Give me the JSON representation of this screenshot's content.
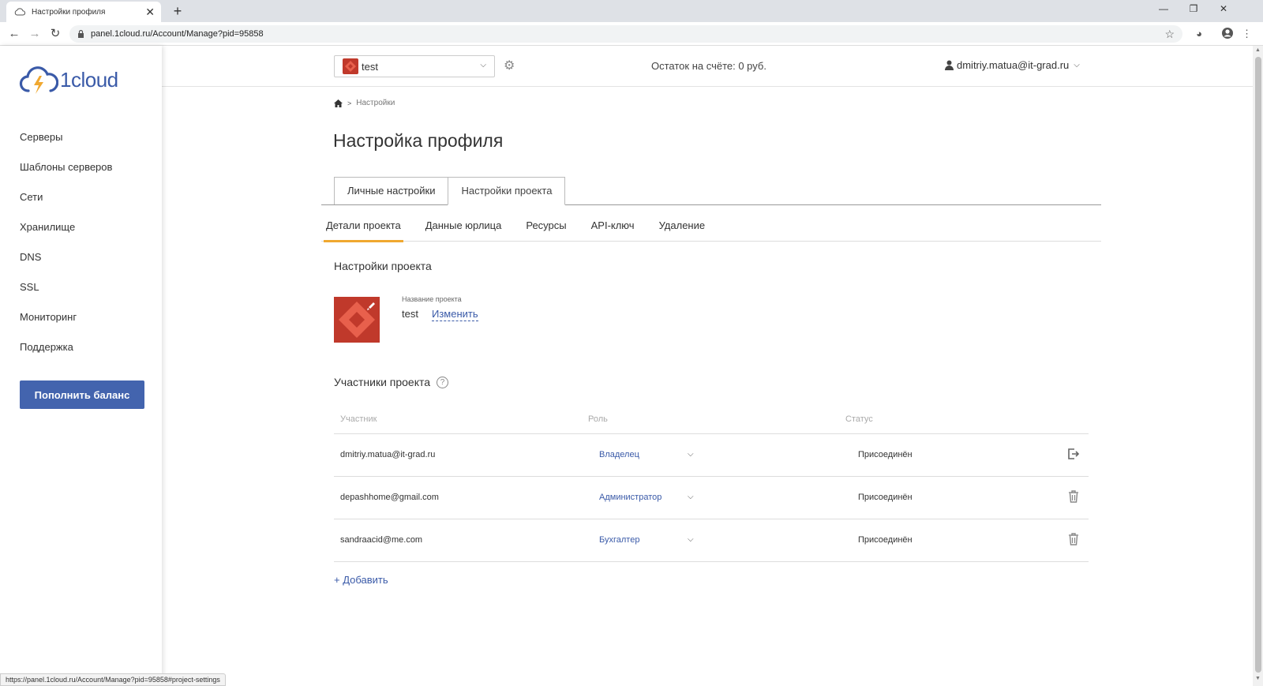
{
  "browser": {
    "tab_title": "Настройки профиля",
    "url": "panel.1cloud.ru/Account/Manage?pid=95858",
    "status_url": "https://panel.1cloud.ru/Account/Manage?pid=95858#project-settings"
  },
  "sidebar": {
    "logo_text": "1cloud",
    "items": [
      {
        "label": "Серверы"
      },
      {
        "label": "Шаблоны серверов"
      },
      {
        "label": "Сети"
      },
      {
        "label": "Хранилище"
      },
      {
        "label": "DNS"
      },
      {
        "label": "SSL"
      },
      {
        "label": "Мониторинг"
      },
      {
        "label": "Поддержка"
      }
    ],
    "topup_label": "Пополнить баланс"
  },
  "header": {
    "project": "test",
    "balance": "Остаток на счёте: 0 руб.",
    "user": "dmitriy.matua@it-grad.ru"
  },
  "main": {
    "breadcrumb": "Настройки",
    "title": "Настройка профиля",
    "tabs": [
      {
        "label": "Личные настройки"
      },
      {
        "label": "Настройки проекта"
      }
    ],
    "subtabs": [
      {
        "label": "Детали проекта"
      },
      {
        "label": "Данные юрлица"
      },
      {
        "label": "Ресурсы"
      },
      {
        "label": "API-ключ"
      },
      {
        "label": "Удаление"
      }
    ],
    "settings_title": "Настройки проекта",
    "project_name_label": "Название проекта",
    "project_name": "test",
    "edit_label": "Изменить",
    "members_title": "Участники проекта",
    "help_icon": "?",
    "columns": {
      "member": "Участник",
      "role": "Роль",
      "status": "Статус"
    },
    "members": [
      {
        "email": "dmitriy.matua@it-grad.ru",
        "role": "Владелец",
        "status": "Присоединён",
        "action_icon": "leave-icon"
      },
      {
        "email": "depashhome@gmail.com",
        "role": "Администратор",
        "status": "Присоединён",
        "action_icon": "trash-icon"
      },
      {
        "email": "sandraacid@me.com",
        "role": "Бухгалтер",
        "status": "Присоединён",
        "action_icon": "trash-icon"
      }
    ],
    "add_label": "+ Добавить"
  },
  "colors": {
    "accent": "#4364ae",
    "link": "#3a5aa8",
    "active_tab_underline": "#f0a830",
    "project_avatar": "#c0392b"
  }
}
